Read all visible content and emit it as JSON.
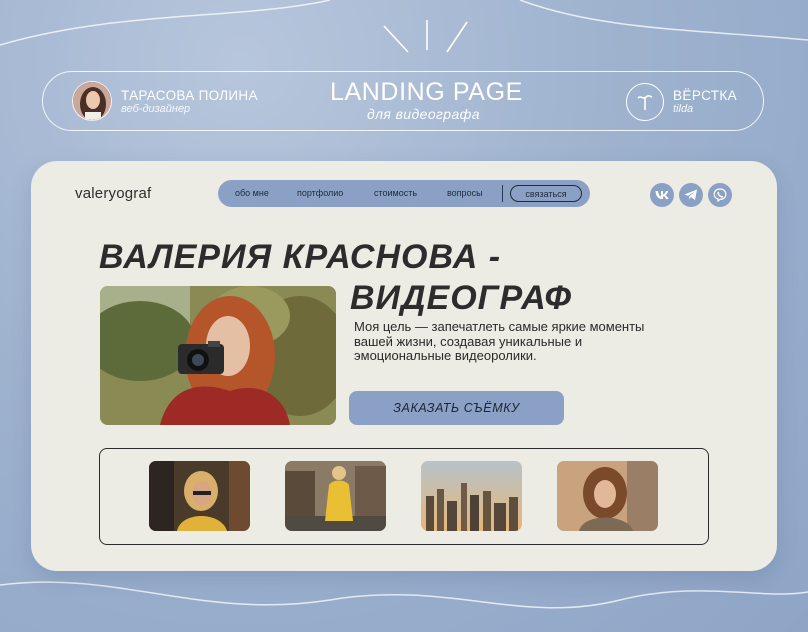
{
  "author": {
    "name": "ТАРАСОВА ПОЛИНА",
    "role": "веб-дизайнер",
    "avatar_icon": "avatar-portrait-icon"
  },
  "project": {
    "title": "LANDING PAGE",
    "subtitle": "для видеографа"
  },
  "tool": {
    "name": "ВЁРСТКА",
    "sub": "tilda",
    "icon": "tilda-logo-icon"
  },
  "site": {
    "logo": "valeryograf",
    "nav": {
      "items": [
        "обо мне",
        "портфолио",
        "стоимость",
        "вопросы"
      ],
      "contact": "связаться"
    },
    "socials": [
      "vk-icon",
      "telegram-icon",
      "viber-icon"
    ],
    "hero": {
      "line1": "ВАЛЕРИЯ КРАСНОВА -",
      "line2": "ВИДЕОГРАФ",
      "description": "Моя цель — запечатлеть самые яркие моменты вашей жизни, создавая уникальные и эмоциональные видеоролики.",
      "cta": "ЗАКАЗАТЬ СЪЁМКУ"
    }
  },
  "colors": {
    "background": "#9fb3cf",
    "card": "#ecebe4",
    "accent": "#8aa1c5",
    "text_dark": "#2c2c2c"
  }
}
